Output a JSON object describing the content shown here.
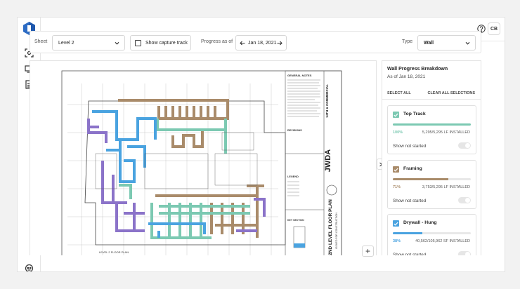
{
  "header": {
    "user_initials": "CB"
  },
  "toolbar": {
    "sheet_label": "Sheet",
    "sheet_value": "Level 2",
    "capture_track_label": "Show capture track",
    "progress_label": "Progress as of",
    "progress_date": "Jan 18, 2021",
    "type_label": "Type",
    "type_value": "Wall"
  },
  "drawing": {
    "general_notes": "GENERAL NOTES",
    "revisions": "REVISIONS",
    "legend": "LEGEND",
    "key_section": "KEY SECTION",
    "firm_logo": "JWDA",
    "project_title": "14TH & COMMERCIAL",
    "sheet_title": "2ND LEVEL FLOOR PLAN",
    "issue_note": "ISSUED FOR CONSTRUCTION",
    "floor_plan_caption": "LEVEL 2 FLOOR PLAN"
  },
  "panel": {
    "title": "Wall Progress Breakdown",
    "subtitle": "As of Jan 18, 2021",
    "select_all": "SELECT ALL",
    "clear_all": "CLEAR ALL SELECTIONS",
    "items": [
      {
        "name": "Top Track",
        "percent": "100%",
        "progress": 1.0,
        "installed": "5,295/5,295 LF INSTALLED",
        "color": "#7cc9b2",
        "show_not_started": "Show not started"
      },
      {
        "name": "Framing",
        "percent": "71%",
        "progress": 0.71,
        "installed": "3,753/5,295 LF INSTALLED",
        "color": "#a98b6a",
        "show_not_started": "Show not started"
      },
      {
        "name": "Drywall - Hung",
        "percent": "38%",
        "progress": 0.38,
        "installed": "40,562/105,962 SF INSTALLED",
        "color": "#4aa3e0",
        "show_not_started": "Show not started"
      }
    ]
  },
  "colors": {
    "accent_blue": "#2d6cc4",
    "top_track": "#7cc9b2",
    "framing": "#a98b6a",
    "drywall": "#4aa3e0",
    "purple": "#8b73c9"
  }
}
